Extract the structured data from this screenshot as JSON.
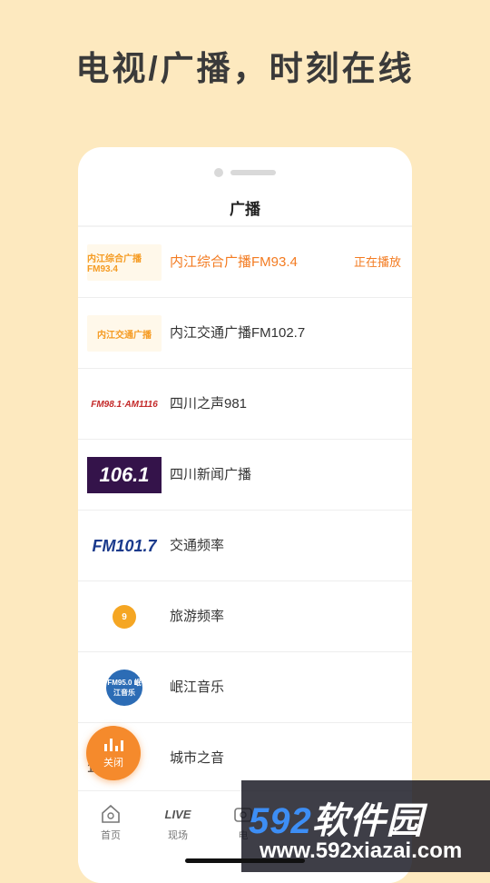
{
  "headline": "电视/广播，时刻在线",
  "screen": {
    "title": "广播"
  },
  "stations": [
    {
      "name": "内江综合广播FM93.4",
      "status": "正在播放",
      "active": true,
      "logo_text": "内江综合广播 FM93.4",
      "logo": "neijiang-general-logo"
    },
    {
      "name": "内江交通广播FM102.7",
      "status": "",
      "active": false,
      "logo_text": "内江交通广播",
      "logo": "neijiang-traffic-logo"
    },
    {
      "name": "四川之声981",
      "status": "",
      "active": false,
      "logo_text": "FM98.1·AM1116",
      "logo": "sichuan-voice-logo"
    },
    {
      "name": "四川新闻广播",
      "status": "",
      "active": false,
      "logo_text": "106.1",
      "logo": "sichuan-news-logo"
    },
    {
      "name": "交通频率",
      "status": "",
      "active": false,
      "logo_text": "FM101.7",
      "logo": "traffic-frequency-logo"
    },
    {
      "name": "旅游频率",
      "status": "",
      "active": false,
      "logo_text": "9",
      "logo": "travel-frequency-logo"
    },
    {
      "name": "岷江音乐",
      "status": "",
      "active": false,
      "logo_text": "FM95.0 岷江音乐",
      "logo": "minjiang-music-logo"
    },
    {
      "name": "城市之音",
      "status": "",
      "active": false,
      "logo_text": "城市之音 102.6",
      "logo": "city-voice-logo"
    }
  ],
  "tabs": [
    {
      "label": "首页",
      "icon": "home-icon"
    },
    {
      "label": "现场",
      "icon": "live-icon",
      "icon_text": "LIVE"
    },
    {
      "label": "电",
      "icon": "tv-icon"
    }
  ],
  "float_button": {
    "label": "关闭",
    "icon": "audio-bars-icon"
  },
  "watermark": {
    "main_num": "592",
    "main_text": "软件园",
    "url": "www.592xiazai.com"
  },
  "colors": {
    "background": "#fde9bf",
    "accent": "#f37b21"
  }
}
